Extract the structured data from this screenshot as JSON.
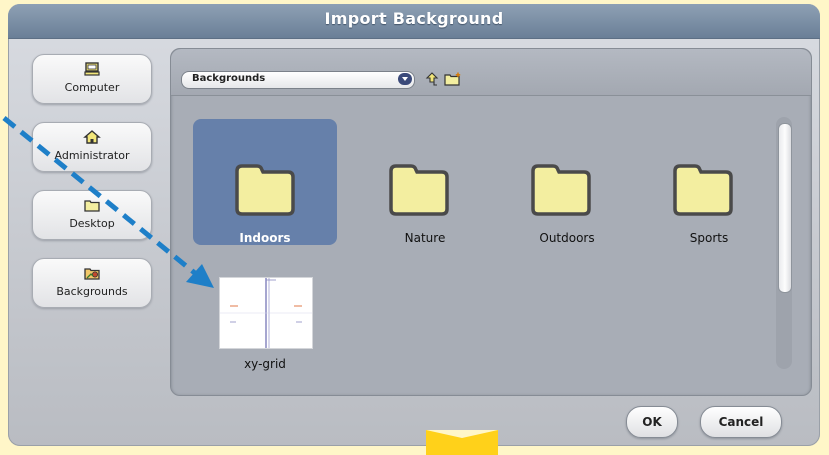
{
  "dialog": {
    "title": "Import Background"
  },
  "sidebar": {
    "items": [
      {
        "label": "Computer",
        "icon": "computer-icon"
      },
      {
        "label": "Administrator",
        "icon": "home-icon"
      },
      {
        "label": "Desktop",
        "icon": "folder-icon"
      },
      {
        "label": "Backgrounds",
        "icon": "backgrounds-icon"
      }
    ]
  },
  "toolbar": {
    "location": "Backgrounds",
    "up_icon": "up-folder-icon",
    "new_folder_icon": "new-folder-icon"
  },
  "files": [
    {
      "name": "Indoors",
      "type": "folder",
      "selected": true
    },
    {
      "name": "Nature",
      "type": "folder",
      "selected": false
    },
    {
      "name": "Outdoors",
      "type": "folder",
      "selected": false
    },
    {
      "name": "Sports",
      "type": "folder",
      "selected": false
    },
    {
      "name": "xy-grid",
      "type": "image",
      "selected": false
    }
  ],
  "buttons": {
    "ok": "OK",
    "cancel": "Cancel"
  },
  "colors": {
    "title_bar": "#6a7f97",
    "selection": "#6680aa",
    "folder_fill": "#f3eea0",
    "annotation_arrow": "#1e7fc8",
    "highlight_tab": "#ffd11a"
  }
}
